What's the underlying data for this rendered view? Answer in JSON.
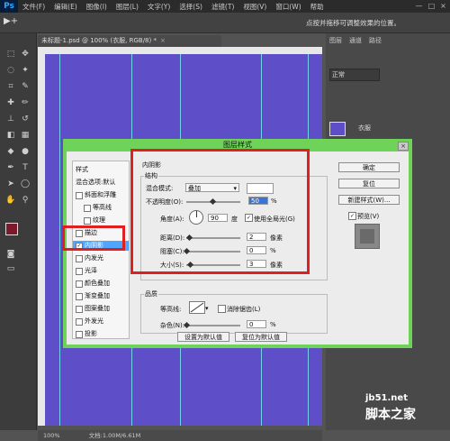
{
  "menubar": {
    "logo": "Ps",
    "items": [
      "文件(F)",
      "编辑(E)",
      "图像(I)",
      "图层(L)",
      "文字(Y)",
      "选择(S)",
      "滤镜(T)",
      "视图(V)",
      "窗口(W)",
      "帮助"
    ],
    "minimize": "—",
    "maximize": "□",
    "close": "×"
  },
  "optbar": {
    "tool_icon": "▶+",
    "hint": "点按并拖移可调整效果的位置。"
  },
  "document": {
    "tab_title": "未标题-1.psd @ 100% (衣服, RGB/8) *",
    "tab_close": "×",
    "status_zoom": "100%",
    "status_doc": "文档:1.00M/6.61M",
    "canvas_color": "#5e4ec7"
  },
  "right_panel": {
    "tabs": [
      "图层",
      "通道",
      "路径"
    ],
    "blend_mode": "正常",
    "layer_name": "衣服"
  },
  "watermark": {
    "url": "jb51.net",
    "name": "脚本之家"
  },
  "dialog": {
    "title": "图层样式",
    "close": "×",
    "styles_header": "样式",
    "styles": [
      {
        "label": "混合选项:默认",
        "checkbox": false,
        "checked": false
      },
      {
        "label": "斜面和浮雕",
        "checkbox": true,
        "checked": false
      },
      {
        "label": "等高线",
        "checkbox": true,
        "checked": false
      },
      {
        "label": "纹理",
        "checkbox": true,
        "checked": false
      },
      {
        "label": "描边",
        "checkbox": true,
        "checked": false
      },
      {
        "label": "内阴影",
        "checkbox": true,
        "checked": true
      },
      {
        "label": "内发光",
        "checkbox": true,
        "checked": false
      },
      {
        "label": "光泽",
        "checkbox": true,
        "checked": false
      },
      {
        "label": "颜色叠加",
        "checkbox": true,
        "checked": false
      },
      {
        "label": "渐变叠加",
        "checkbox": true,
        "checked": false
      },
      {
        "label": "图案叠加",
        "checkbox": true,
        "checked": false
      },
      {
        "label": "外发光",
        "checkbox": true,
        "checked": false
      },
      {
        "label": "投影",
        "checkbox": true,
        "checked": false
      }
    ],
    "inner_shadow": {
      "section_title": "内阴影",
      "structure_title": "结构",
      "blend_label": "混合模式:",
      "blend_value": "叠加",
      "opacity_label": "不透明度(O):",
      "opacity_value": "50",
      "opacity_unit": "%",
      "angle_label": "角度(A):",
      "angle_value": "90",
      "angle_unit": "度",
      "global_light_label": "使用全局光(G)",
      "global_light_checked": true,
      "distance_label": "距离(D):",
      "distance_value": "2",
      "distance_unit": "像素",
      "choke_label": "阻塞(C):",
      "choke_value": "0",
      "choke_unit": "%",
      "size_label": "大小(S):",
      "size_value": "3",
      "size_unit": "像素"
    },
    "quality": {
      "title": "品质",
      "contour_label": "等高线:",
      "antialias_label": "消除锯齿(L)",
      "noise_label": "杂色(N):",
      "noise_value": "0",
      "noise_unit": "%"
    },
    "buttons": {
      "set_default": "设置为默认值",
      "reset_default": "复位为默认值",
      "ok": "确定",
      "reset": "复位",
      "new_style": "新建样式(W)...",
      "preview": "预览(V)"
    }
  }
}
